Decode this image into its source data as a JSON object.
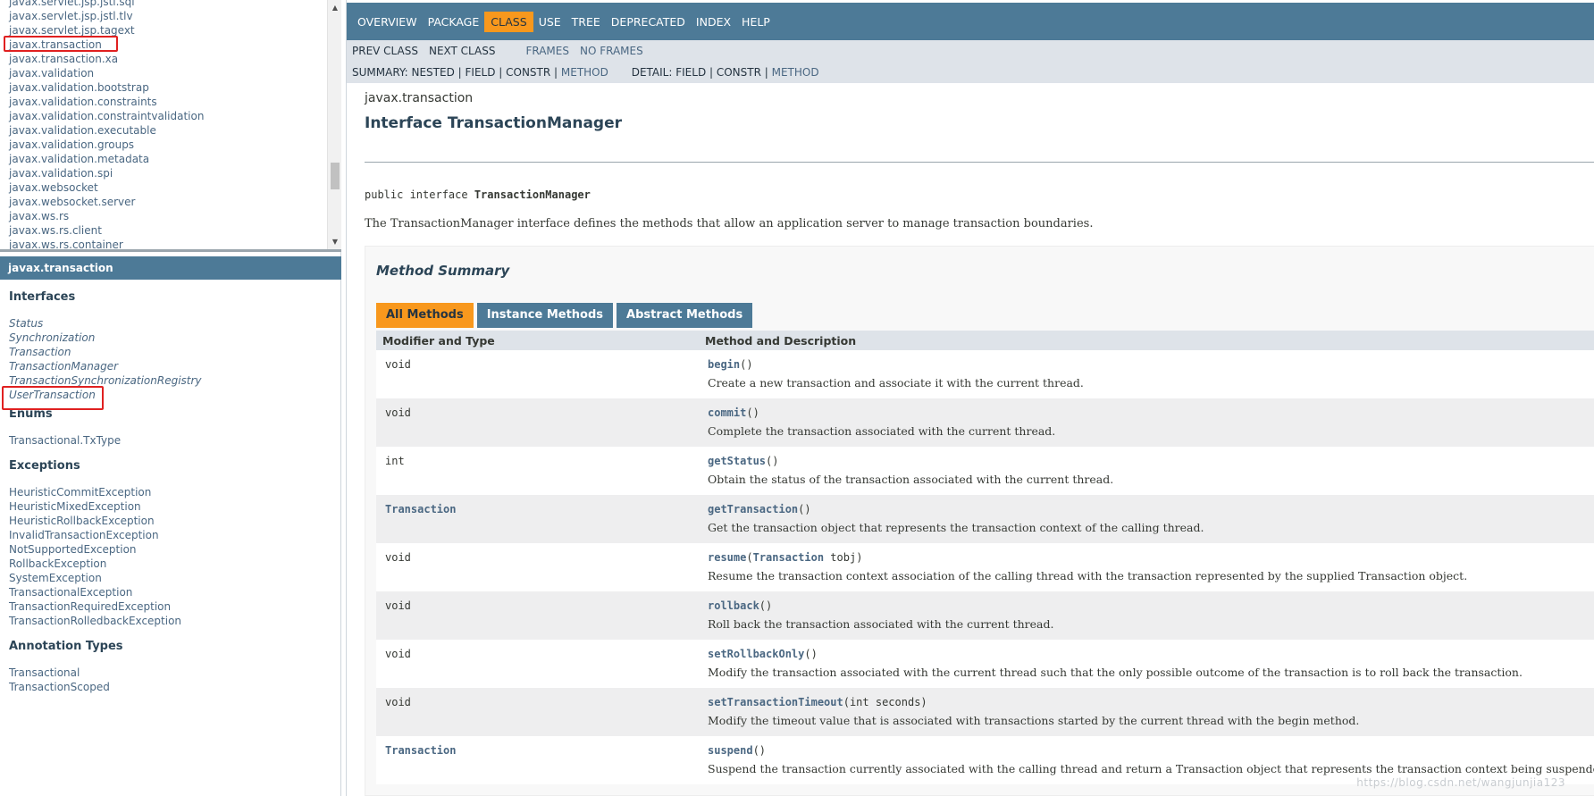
{
  "packages_frame": {
    "items": [
      "javax.servlet.jsp.jstl.sql",
      "javax.servlet.jsp.jstl.tlv",
      "javax.servlet.jsp.tagext",
      "javax.transaction",
      "javax.transaction.xa",
      "javax.validation",
      "javax.validation.bootstrap",
      "javax.validation.constraints",
      "javax.validation.constraintvalidation",
      "javax.validation.executable",
      "javax.validation.groups",
      "javax.validation.metadata",
      "javax.validation.spi",
      "javax.websocket",
      "javax.websocket.server",
      "javax.ws.rs",
      "javax.ws.rs.client",
      "javax.ws.rs.container"
    ]
  },
  "classes_frame": {
    "package_title": "javax.transaction",
    "interfaces_heading": "Interfaces",
    "interfaces": [
      "Status",
      "Synchronization",
      "Transaction",
      "TransactionManager",
      "TransactionSynchronizationRegistry",
      "UserTransaction"
    ],
    "enums_heading": "Enums",
    "enums": [
      "Transactional.TxType"
    ],
    "exceptions_heading": "Exceptions",
    "exceptions": [
      "HeuristicCommitException",
      "HeuristicMixedException",
      "HeuristicRollbackException",
      "InvalidTransactionException",
      "NotSupportedException",
      "RollbackException",
      "SystemException",
      "TransactionalException",
      "TransactionRequiredException",
      "TransactionRolledbackException"
    ],
    "annotations_heading": "Annotation Types",
    "annotations": [
      "Transactional",
      "TransactionScoped"
    ]
  },
  "top_nav": {
    "items": [
      "Overview",
      "Package",
      "Class",
      "Use",
      "Tree",
      "Deprecated",
      "Index",
      "Help"
    ],
    "active": "Class"
  },
  "sub_nav": {
    "prev_class": "Prev Class",
    "next_class": "Next Class",
    "frames": "Frames",
    "no_frames": "No Frames",
    "summary_label": "Summary:",
    "summary_nested": "Nested",
    "summary_field": "Field",
    "summary_constr": "Constr",
    "summary_method": "Method",
    "detail_label": "Detail:",
    "detail_field": "Field",
    "detail_constr": "Constr",
    "detail_method": "Method",
    "separator": " | "
  },
  "header": {
    "package": "javax.transaction",
    "title": "Interface TransactionManager"
  },
  "signature": {
    "prefix": "public interface ",
    "name": "TransactionManager"
  },
  "description": "The TransactionManager interface defines the methods that allow an application server to manage transaction boundaries.",
  "method_summary": {
    "title": "Method Summary",
    "tabs": [
      "All Methods",
      "Instance Methods",
      "Abstract Methods"
    ],
    "active_tab": "All Methods",
    "col_modifier": "Modifier and Type",
    "col_method": "Method and Description",
    "rows": [
      {
        "type": "void",
        "type_link": false,
        "name": "begin",
        "params": "()",
        "desc": "Create a new transaction and associate it with the current thread."
      },
      {
        "type": "void",
        "type_link": false,
        "name": "commit",
        "params": "()",
        "desc": "Complete the transaction associated with the current thread."
      },
      {
        "type": "int",
        "type_link": false,
        "name": "getStatus",
        "params": "()",
        "desc": "Obtain the status of the transaction associated with the current thread."
      },
      {
        "type": "Transaction",
        "type_link": true,
        "name": "getTransaction",
        "params": "()",
        "desc": "Get the transaction object that represents the transaction context of the calling thread."
      },
      {
        "type": "void",
        "type_link": false,
        "name": "resume",
        "param_type": "Transaction",
        "param_rest": "  tobj)",
        "params": "(",
        "desc": "Resume the transaction context association of the calling thread with the transaction represented by the supplied Transaction object."
      },
      {
        "type": "void",
        "type_link": false,
        "name": "rollback",
        "params": "()",
        "desc": "Roll back the transaction associated with the current thread."
      },
      {
        "type": "void",
        "type_link": false,
        "name": "setRollbackOnly",
        "params": "()",
        "desc": "Modify the transaction associated with the current thread such that the only possible outcome of the transaction is to roll back the transaction."
      },
      {
        "type": "void",
        "type_link": false,
        "name": "setTransactionTimeout",
        "params": "(int  seconds)",
        "desc": "Modify the timeout value that is associated with transactions started by the current thread with the begin method."
      },
      {
        "type": "Transaction",
        "type_link": true,
        "name": "suspend",
        "params": "()",
        "desc": "Suspend the transaction currently associated with the calling thread and return a Transaction object that represents the transaction context being suspended."
      }
    ]
  },
  "watermark": "https://blog.csdn.net/wangjunjia123",
  "colors": {
    "nav_bg": "#4D7A97",
    "subnav_bg": "#dee3e9",
    "active_orange": "#F8981D",
    "link": "#4A6782",
    "highlight_box": "#e02020"
  }
}
